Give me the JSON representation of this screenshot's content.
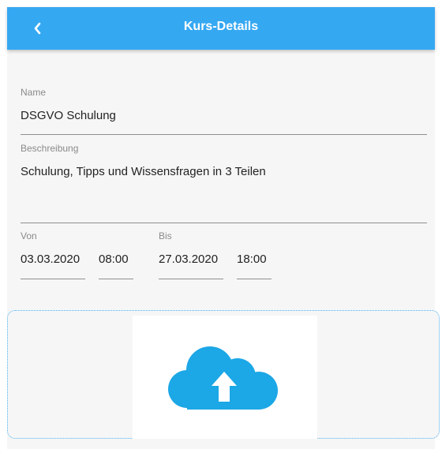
{
  "header": {
    "title": "Kurs-Details",
    "back_icon": "chevron-left-icon",
    "color": "#35a8f2"
  },
  "form": {
    "name": {
      "label": "Name",
      "value": "DSGVO Schulung"
    },
    "description": {
      "label": "Beschreibung",
      "value": "Schulung, Tipps und Wissensfragen in 3 Teilen"
    },
    "from": {
      "label": "Von",
      "date": "03.03.2020",
      "time": "08:00"
    },
    "to": {
      "label": "Bis",
      "date": "27.03.2020",
      "time": "18:00"
    }
  },
  "upload": {
    "icon": "cloud-upload-icon",
    "icon_color": "#1ca7e6"
  }
}
